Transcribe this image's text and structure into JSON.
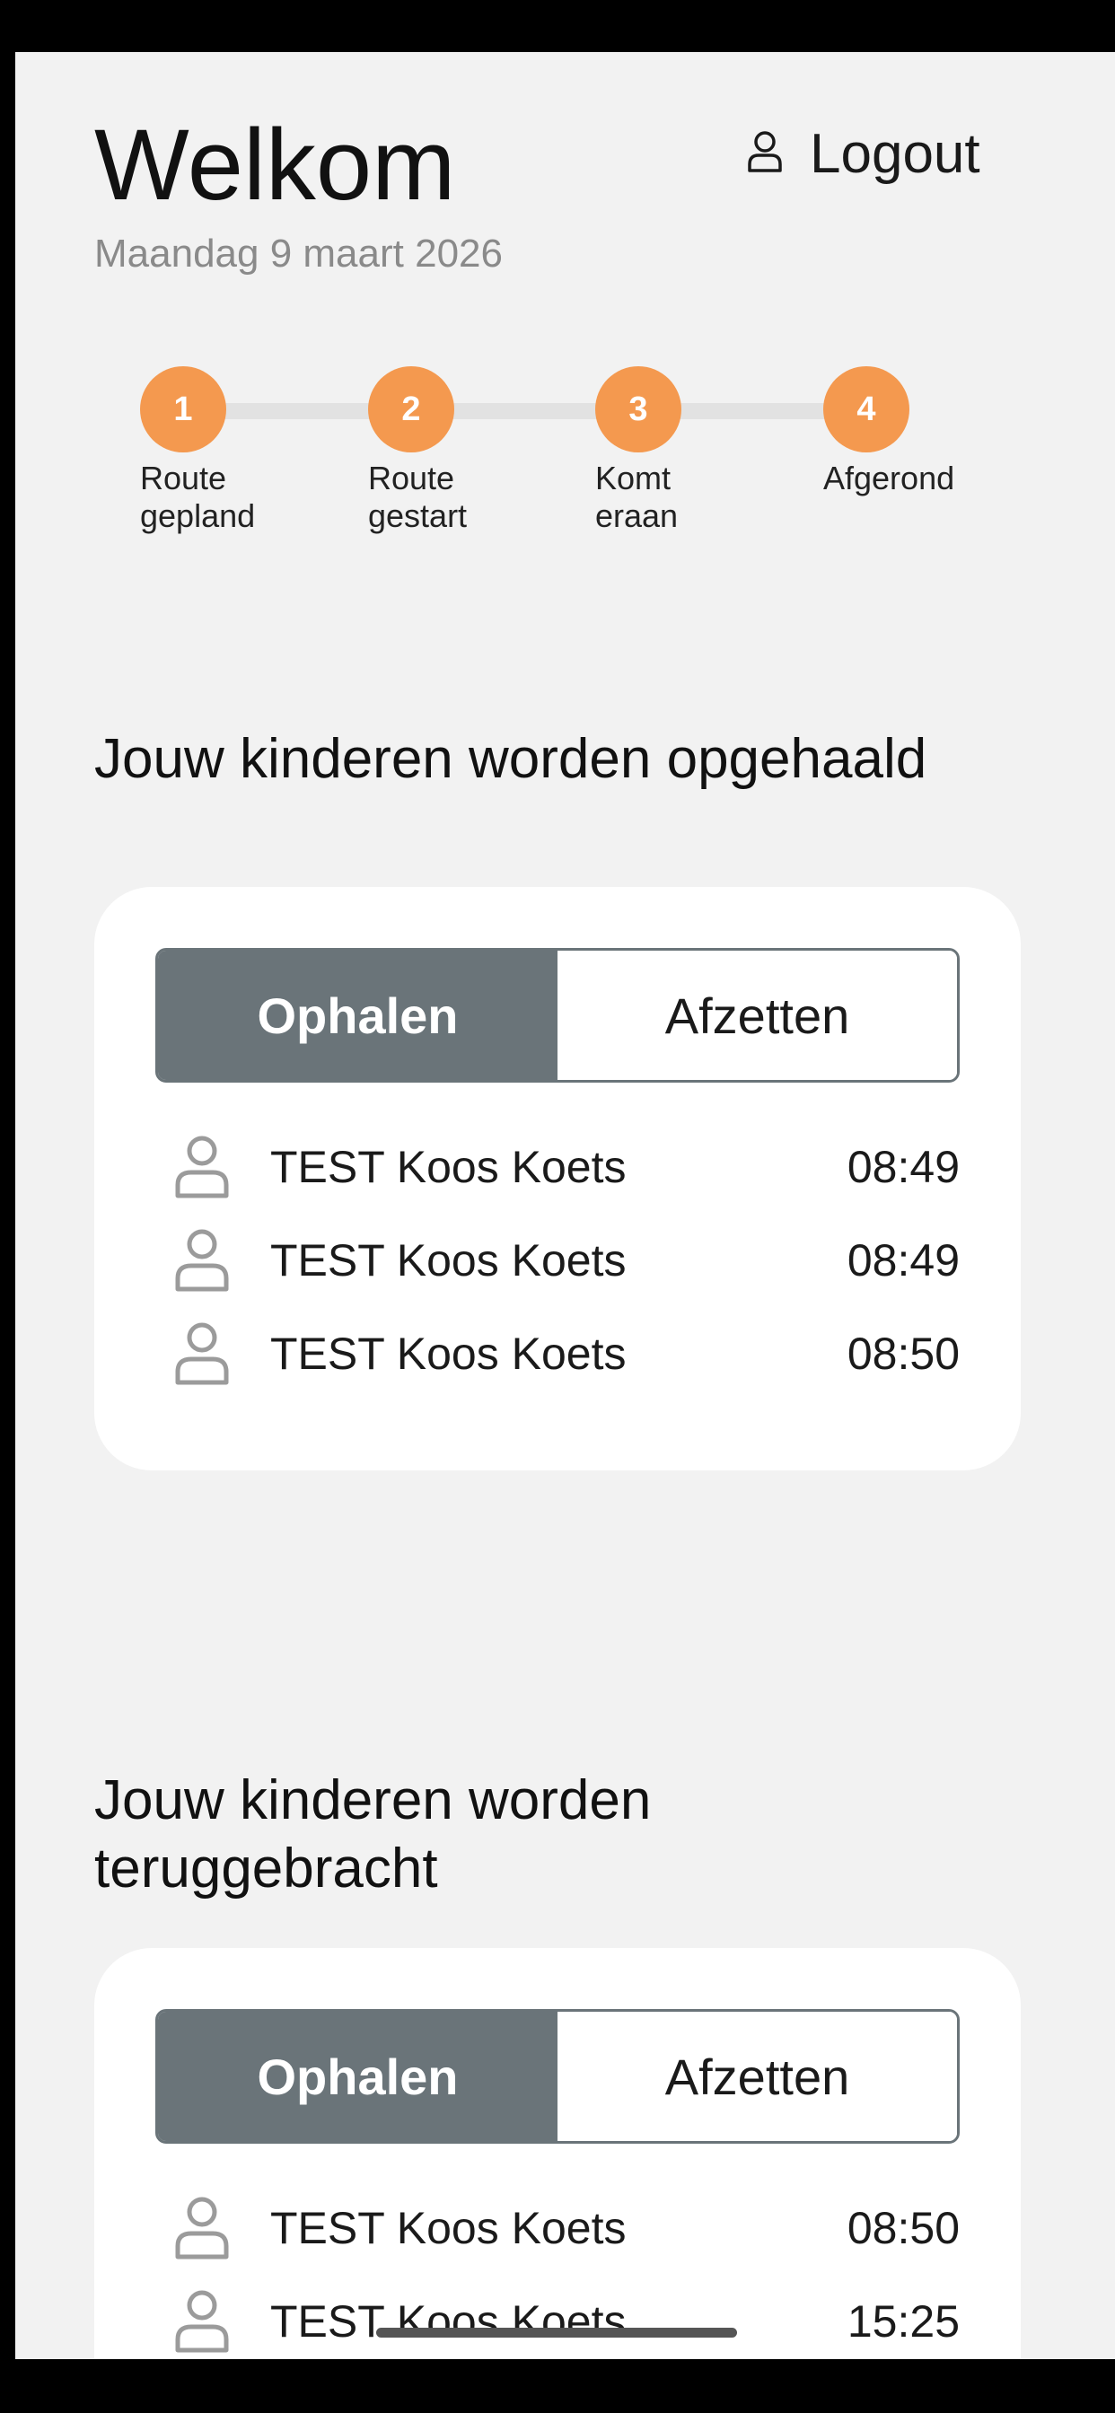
{
  "header": {
    "title": "Welkom",
    "date": "Maandag 9 maart 2026",
    "logout_label": "Logout",
    "logout_icon": "user-outline-icon"
  },
  "steps": [
    {
      "number": "1",
      "label": "Route\ngepland"
    },
    {
      "number": "2",
      "label": "Route\ngestart"
    },
    {
      "number": "3",
      "label": "Komt\neraan"
    },
    {
      "number": "4",
      "label": "Afgerond"
    }
  ],
  "sections": [
    {
      "heading": "Jouw kinderen worden opgehaald",
      "tabs": {
        "active": "Ophalen",
        "inactive": "Afzetten"
      },
      "children": [
        {
          "name": "TEST Koos Koets",
          "time": "08:49"
        },
        {
          "name": "TEST Koos Koets",
          "time": "08:49"
        },
        {
          "name": "TEST Koos Koets",
          "time": "08:50"
        }
      ]
    },
    {
      "heading": "Jouw kinderen worden teruggebracht",
      "tabs": {
        "active": "Ophalen",
        "inactive": "Afzetten"
      },
      "children": [
        {
          "name": "TEST Koos Koets",
          "time": "08:50"
        },
        {
          "name": "TEST Koos Koets",
          "time": "15:25"
        }
      ]
    }
  ],
  "colors": {
    "accent": "#f4994f",
    "segment_active": "#6a7479",
    "background": "#f2f2f2",
    "card": "#ffffff"
  }
}
